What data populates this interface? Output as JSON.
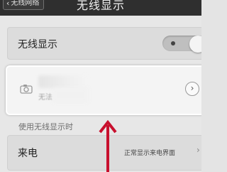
{
  "header": {
    "back_label": "无线网络",
    "title": "无线显示"
  },
  "wireless_display": {
    "label": "无线显示",
    "toggle_state": "off"
  },
  "device": {
    "subtitle": "无法"
  },
  "section": {
    "header": "使用无线显示时"
  },
  "incoming_call": {
    "label": "来电",
    "value": "正常显示来电界面"
  },
  "colors": {
    "annotation_arrow": "#c8102e",
    "topbar": "#2f2f2f"
  },
  "icons": [
    "back-chevron-icon",
    "camera-icon",
    "chevron-right-icon",
    "annotation-arrow-icon"
  ]
}
